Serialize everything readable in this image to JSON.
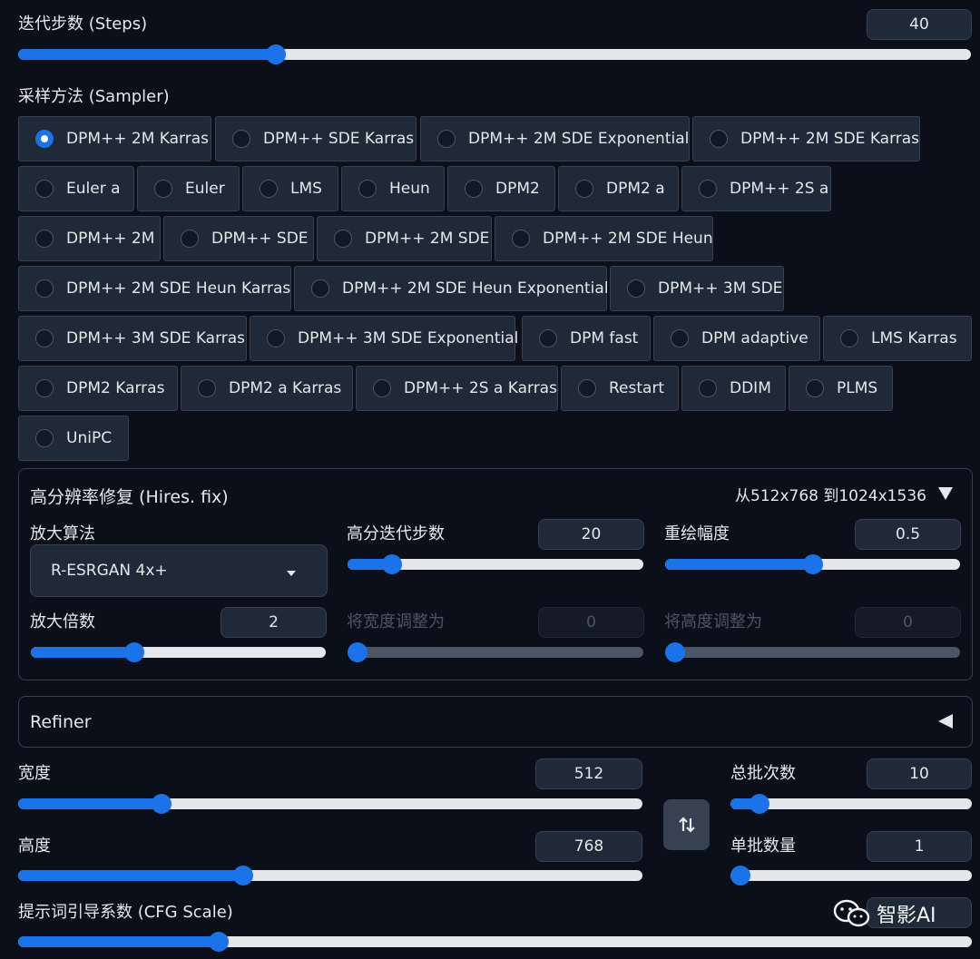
{
  "steps": {
    "label": "迭代步数 (Steps)",
    "value": "40",
    "fraction": 0.27
  },
  "sampler": {
    "label": "采样方法 (Sampler)",
    "selected": "DPM++ 2M Karras",
    "options": [
      "DPM++ 2M Karras",
      "DPM++ SDE Karras",
      "DPM++ 2M SDE Exponential",
      "DPM++ 2M SDE Karras",
      "Euler a",
      "Euler",
      "LMS",
      "Heun",
      "DPM2",
      "DPM2 a",
      "DPM++ 2S a",
      "DPM++ 2M",
      "DPM++ SDE",
      "DPM++ 2M SDE",
      "DPM++ 2M SDE Heun",
      "DPM++ 2M SDE Heun Karras",
      "DPM++ 2M SDE Heun Exponential",
      "DPM++ 3M SDE",
      "DPM++ 3M SDE Karras",
      "DPM++ 3M SDE Exponential",
      "DPM fast",
      "DPM adaptive",
      "LMS Karras",
      "DPM2 Karras",
      "DPM2 a Karras",
      "DPM++ 2S a Karras",
      "Restart",
      "DDIM",
      "PLMS",
      "UniPC"
    ]
  },
  "hires": {
    "title": "高分辨率修复 (Hires. fix)",
    "summary": "从512x768 到1024x1536",
    "upscaler": {
      "label": "放大算法",
      "value": "R-ESRGAN 4x+"
    },
    "hires_steps": {
      "label": "高分迭代步数",
      "value": "20",
      "fraction": 0.15
    },
    "denoise": {
      "label": "重绘幅度",
      "value": "0.5",
      "fraction": 0.5
    },
    "upscale_by": {
      "label": "放大倍数",
      "value": "2",
      "fraction": 0.35
    },
    "resize_width": {
      "label": "将宽度调整为",
      "value": "0",
      "fraction": 0
    },
    "resize_height": {
      "label": "将高度调整为",
      "value": "0",
      "fraction": 0
    }
  },
  "refiner": {
    "label": "Refiner"
  },
  "width": {
    "label": "宽度",
    "value": "512",
    "fraction": 0.23
  },
  "height": {
    "label": "高度",
    "value": "768",
    "fraction": 0.36
  },
  "batch_count": {
    "label": "总批次数",
    "value": "10",
    "fraction": 0.12
  },
  "batch_size": {
    "label": "单批数量",
    "value": "1",
    "fraction": 0
  },
  "cfg": {
    "label": "提示词引导系数 (CFG Scale)",
    "fraction": 0.21
  },
  "watermark": {
    "text": "智影AI"
  },
  "colors": {
    "accent": "#1a73e8",
    "background": "#0b0f19",
    "panel": "#1f2937"
  }
}
